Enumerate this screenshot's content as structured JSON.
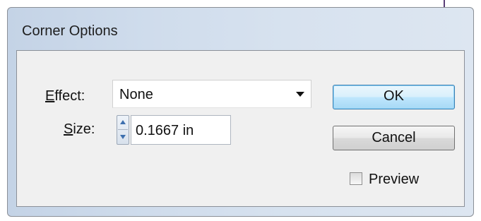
{
  "dialog": {
    "title": "Corner Options"
  },
  "effect": {
    "label_accel": "E",
    "label_rest": "ffect:",
    "value": "None"
  },
  "size": {
    "label_accel": "S",
    "label_rest": "ize:",
    "value": "0.1667 in"
  },
  "buttons": {
    "ok": "OK",
    "cancel": "Cancel"
  },
  "preview": {
    "label": "Preview",
    "checked": false
  },
  "colors": {
    "frame_gradient_start": "#c4d3e6",
    "frame_gradient_end": "#dde6f1",
    "content_background": "#f0f0f0",
    "ok_button_border": "#3c7fb1"
  },
  "icons": {
    "dropdown": "chevron-down-icon",
    "spin_up": "arrow-up-icon",
    "spin_down": "arrow-down-icon"
  }
}
